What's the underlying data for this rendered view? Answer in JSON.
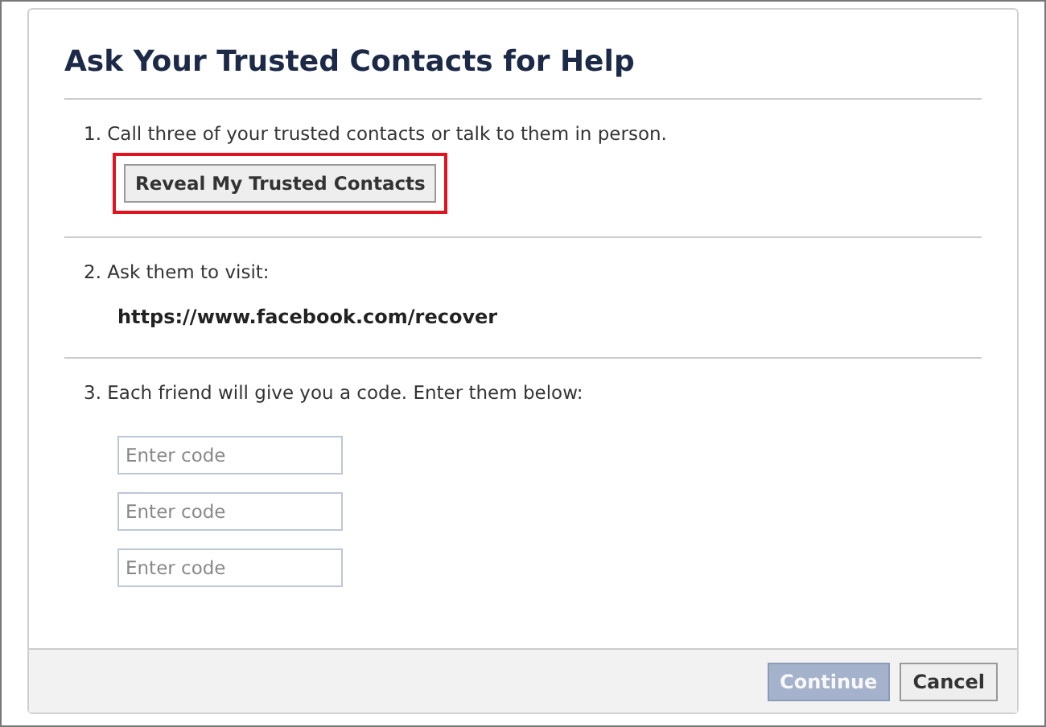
{
  "dialog": {
    "title": "Ask Your Trusted Contacts for Help",
    "steps": [
      {
        "kind": "button",
        "text": "1. Call three of your trusted contacts or talk to them in person.",
        "button": {
          "label": "Reveal My Trusted Contacts",
          "highlighted": true
        }
      },
      {
        "kind": "link",
        "text": "2. Ask them to visit:",
        "url": "https://www.facebook.com/recover"
      },
      {
        "kind": "codes",
        "text": "3. Each friend will give you a code. Enter them below:",
        "fields": [
          {
            "placeholder": "Enter code"
          },
          {
            "placeholder": "Enter code"
          },
          {
            "placeholder": "Enter code"
          }
        ]
      }
    ],
    "buttons": [
      {
        "label": "Continue",
        "kind": "primary",
        "disabled": true
      },
      {
        "label": "Cancel",
        "kind": "secondary",
        "disabled": false
      }
    ]
  }
}
